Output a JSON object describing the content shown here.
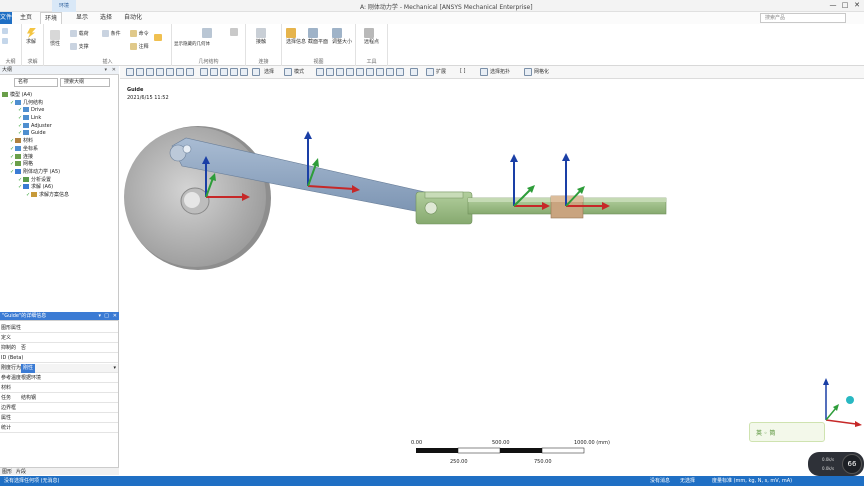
{
  "window": {
    "title": "A: 刚体动力学 - Mechanical [ANSYS Mechanical Enterprise]",
    "context_tab": "环境",
    "minimize": "—",
    "maximize": "□",
    "close": "✕"
  },
  "ribbon": {
    "file_tab": "文件",
    "tabs": [
      "主页",
      "环境",
      "显示",
      "选择",
      "自动化"
    ],
    "active_tab": "环境",
    "search_placeholder": "搜索产品",
    "groups": [
      {
        "label": "大纲",
        "buttons": [
          "复制",
          "剪切",
          "删除"
        ]
      },
      {
        "label": "求解",
        "buttons": [
          "求解"
        ]
      },
      {
        "label": "插入",
        "buttons": [
          "惯性",
          "载荷",
          "支撑",
          "条件",
          "命令",
          "注释"
        ]
      },
      {
        "label": "几何结构",
        "buttons": [
          "显示隐藏的几何体",
          "显示"
        ]
      },
      {
        "label": "连接",
        "buttons": [
          "接触"
        ]
      },
      {
        "label": "视图",
        "buttons": [
          "选择信息",
          "截面平面",
          "调整大小"
        ]
      },
      {
        "label": "工具",
        "buttons": [
          "远程点"
        ]
      }
    ]
  },
  "toolbar": {
    "items": [
      "选择",
      "模式",
      "扩展",
      "选择拓扑",
      "网格化"
    ],
    "item_expand": "扩展",
    "item_topology": "选择拓扑"
  },
  "outline": {
    "header": "大纲",
    "filter_label": "名称",
    "search_placeholder": "搜索大纲",
    "tree": [
      {
        "label": "模型 (A4)",
        "level": 0
      },
      {
        "label": "几何结构",
        "level": 1
      },
      {
        "label": "Drive",
        "level": 2
      },
      {
        "label": "Link",
        "level": 2
      },
      {
        "label": "Adjuster",
        "level": 2
      },
      {
        "label": "Guide",
        "level": 2
      },
      {
        "label": "材料",
        "level": 1
      },
      {
        "label": "坐标系",
        "level": 1
      },
      {
        "label": "连接",
        "level": 1
      },
      {
        "label": "网格",
        "level": 1
      },
      {
        "label": "刚体动力学 (A5)",
        "level": 1
      },
      {
        "label": "分析设置",
        "level": 2
      },
      {
        "label": "求解 (A6)",
        "level": 2
      },
      {
        "label": "求解方案信息",
        "level": 3
      }
    ]
  },
  "details": {
    "header": "\"Guide\"的详细信息",
    "rows": [
      {
        "k": "图形属性",
        "v": ""
      },
      {
        "k": "定义",
        "v": ""
      },
      {
        "k": "抑制的",
        "v": "否"
      },
      {
        "k": "ID (Beta)",
        "v": ""
      },
      {
        "k": "刚度行为",
        "v": "刚性"
      },
      {
        "k": "参考温度",
        "v": "根据环境"
      },
      {
        "k": "材料",
        "v": ""
      },
      {
        "k": "任务",
        "v": "结构钢"
      },
      {
        "k": "边界框",
        "v": ""
      },
      {
        "k": "属性",
        "v": ""
      },
      {
        "k": "统计",
        "v": ""
      }
    ],
    "selected_row": "刚度行为"
  },
  "pane_tabs": [
    "图形",
    "片段"
  ],
  "viewport": {
    "object_name": "Guide",
    "date": "2021/6/15 11:52",
    "scale_labels": [
      "0.00",
      "500.00",
      "1000.00 (mm)",
      "250.00",
      "750.00"
    ],
    "fps": "66",
    "fps_unit": "×",
    "stat_up": "0.0k/s",
    "stat_down": "0.0k/s",
    "eco_text": "英 ◦ 简"
  },
  "statusbar": {
    "left": "没有选择任何项 (无消息)",
    "messages": "没有消息",
    "selection": "无选择",
    "units": "度量标准 (mm, kg, N, s, mV, mA)"
  },
  "colors": {
    "accent": "#1f6fc4",
    "part_green": "#9bbf83",
    "disk_gray": "#b8b8b8",
    "link_blue": "#8fa6c2",
    "slider_tan": "#c9a47f",
    "axis_x": "#c62828",
    "axis_y": "#2e9d3a",
    "axis_z": "#1a3fa6"
  }
}
